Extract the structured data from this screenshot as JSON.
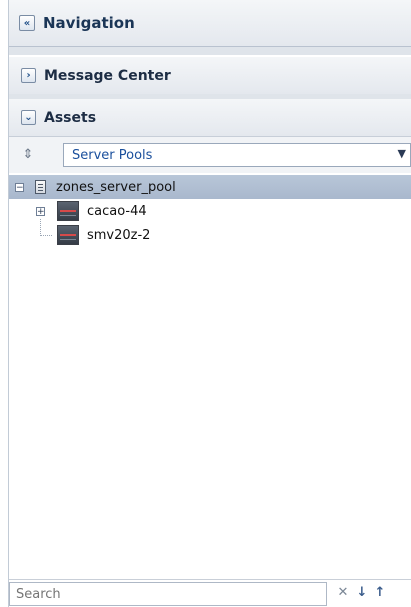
{
  "navigation": {
    "title": "Navigation",
    "collapse_icon": "double-chevron-left-icon"
  },
  "message_center": {
    "title": "Message Center",
    "expand_icon": "chevron-right-icon",
    "expanded": false
  },
  "assets": {
    "title": "Assets",
    "expand_icon": "chevron-down-icon",
    "expanded": true,
    "filter_icon": "sort-arrows-icon",
    "selector": {
      "selected": "Server Pools"
    }
  },
  "tree": {
    "root": {
      "label": "zones_server_pool",
      "expanded": true,
      "selected": true,
      "icon": "server-pool-icon"
    },
    "children": [
      {
        "label": "cacao-44",
        "icon": "server-icon",
        "has_children": true,
        "expanded": false
      },
      {
        "label": "smv20z-2",
        "icon": "server-icon",
        "has_children": false
      }
    ]
  },
  "search": {
    "placeholder": "Search",
    "clear_icon": "close-icon",
    "next_icon": "arrow-down-icon",
    "prev_icon": "arrow-up-icon"
  }
}
